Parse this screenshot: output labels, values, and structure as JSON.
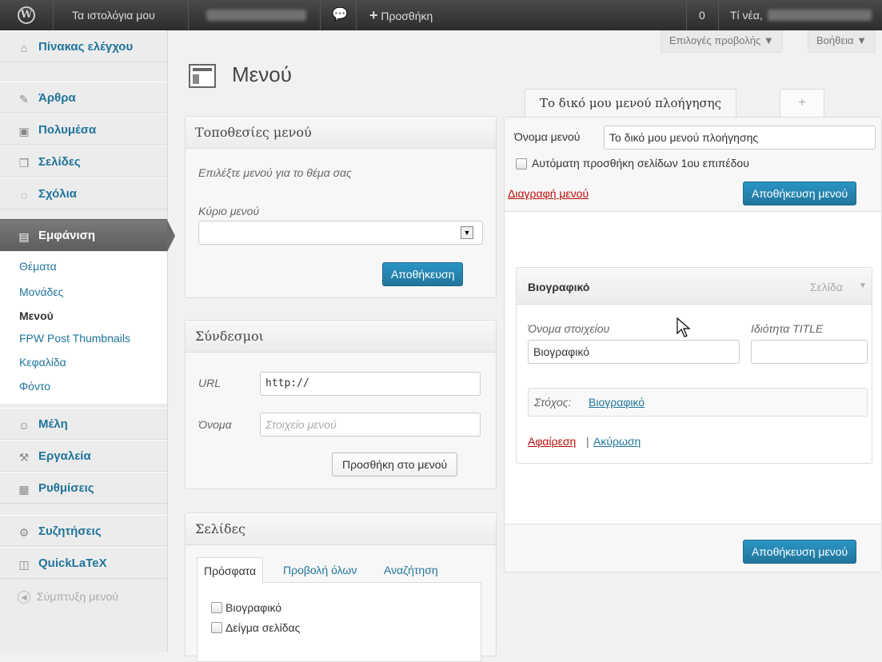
{
  "adminbar": {
    "my_sites": "Τα ιστολόγια μου",
    "add_new": "Προσθήκη",
    "comment_count": "0",
    "new_label": "Τί νέα,"
  },
  "sidebar": {
    "items": [
      {
        "label": "Πίνακας ελέγχου",
        "icon": "dashboard-icon"
      },
      {
        "label": "Άρθρα",
        "icon": "pin-icon"
      },
      {
        "label": "Πολυμέσα",
        "icon": "media-icon"
      },
      {
        "label": "Σελίδες",
        "icon": "pages-icon"
      },
      {
        "label": "Σχόλια",
        "icon": "comments-icon"
      },
      {
        "label": "Εμφάνιση",
        "icon": "appearance-icon"
      },
      {
        "label": "Μέλη",
        "icon": "users-icon"
      },
      {
        "label": "Εργαλεία",
        "icon": "tools-icon"
      },
      {
        "label": "Ρυθμίσεις",
        "icon": "settings-icon"
      },
      {
        "label": "Συζητήσεις",
        "icon": "gear-icon"
      },
      {
        "label": "QuickLaTeX",
        "icon": "plugin-icon"
      }
    ],
    "submenu": [
      "Θέματα",
      "Μονάδες",
      "Μενού",
      "FPW Post Thumbnails",
      "Κεφαλίδα",
      "Φόντο"
    ],
    "collapse": "Σύμπτυξη μενού"
  },
  "header": {
    "title": "Μενού",
    "screen_options": "Επιλογές προβολής ▼",
    "help": "Βοήθεια ▼"
  },
  "locations": {
    "title": "Τοποθεσίες μενού",
    "description": "Επιλέξτε μενού για το θέμα σας",
    "primary_label": "Κύριο μενού",
    "primary_value": "",
    "save": "Αποθήκευση"
  },
  "links": {
    "title": "Σύνδεσμοι",
    "url_label": "URL",
    "url_value": "http://",
    "name_label": "Όνομα",
    "name_placeholder": "Στοιχείο μενού",
    "add_button": "Προσθήκη στο μενού"
  },
  "pages": {
    "title": "Σελίδες",
    "tabs": [
      "Πρόσφατα",
      "Προβολή όλων",
      "Αναζήτηση"
    ],
    "items": [
      "Βιογραφικό",
      "Δείγμα σελίδας"
    ]
  },
  "menu_editor": {
    "tab_label": "Το δικό μου μενού πλοήγησης",
    "add_tab": "+",
    "name_label": "Όνομα μενού",
    "name_value": "Το δικό μου μενού πλοήγησης",
    "auto_add": "Αυτόματη προσθήκη σελίδων 1ου επιπέδου",
    "delete": "Διαγραφή μενού",
    "save": "Αποθήκευση μενού"
  },
  "menu_item": {
    "title": "Βιογραφικό",
    "type": "Σελίδα",
    "label_name": "Όνομα στοιχείου",
    "value_name": "Βιογραφικό",
    "label_title": "Ιδιότητα TITLE",
    "value_title": "",
    "original_label": "Στόχος:",
    "original_link": "Βιογραφικό",
    "remove": "Αφαίρεση",
    "separator": "|",
    "cancel": "Ακύρωση"
  }
}
